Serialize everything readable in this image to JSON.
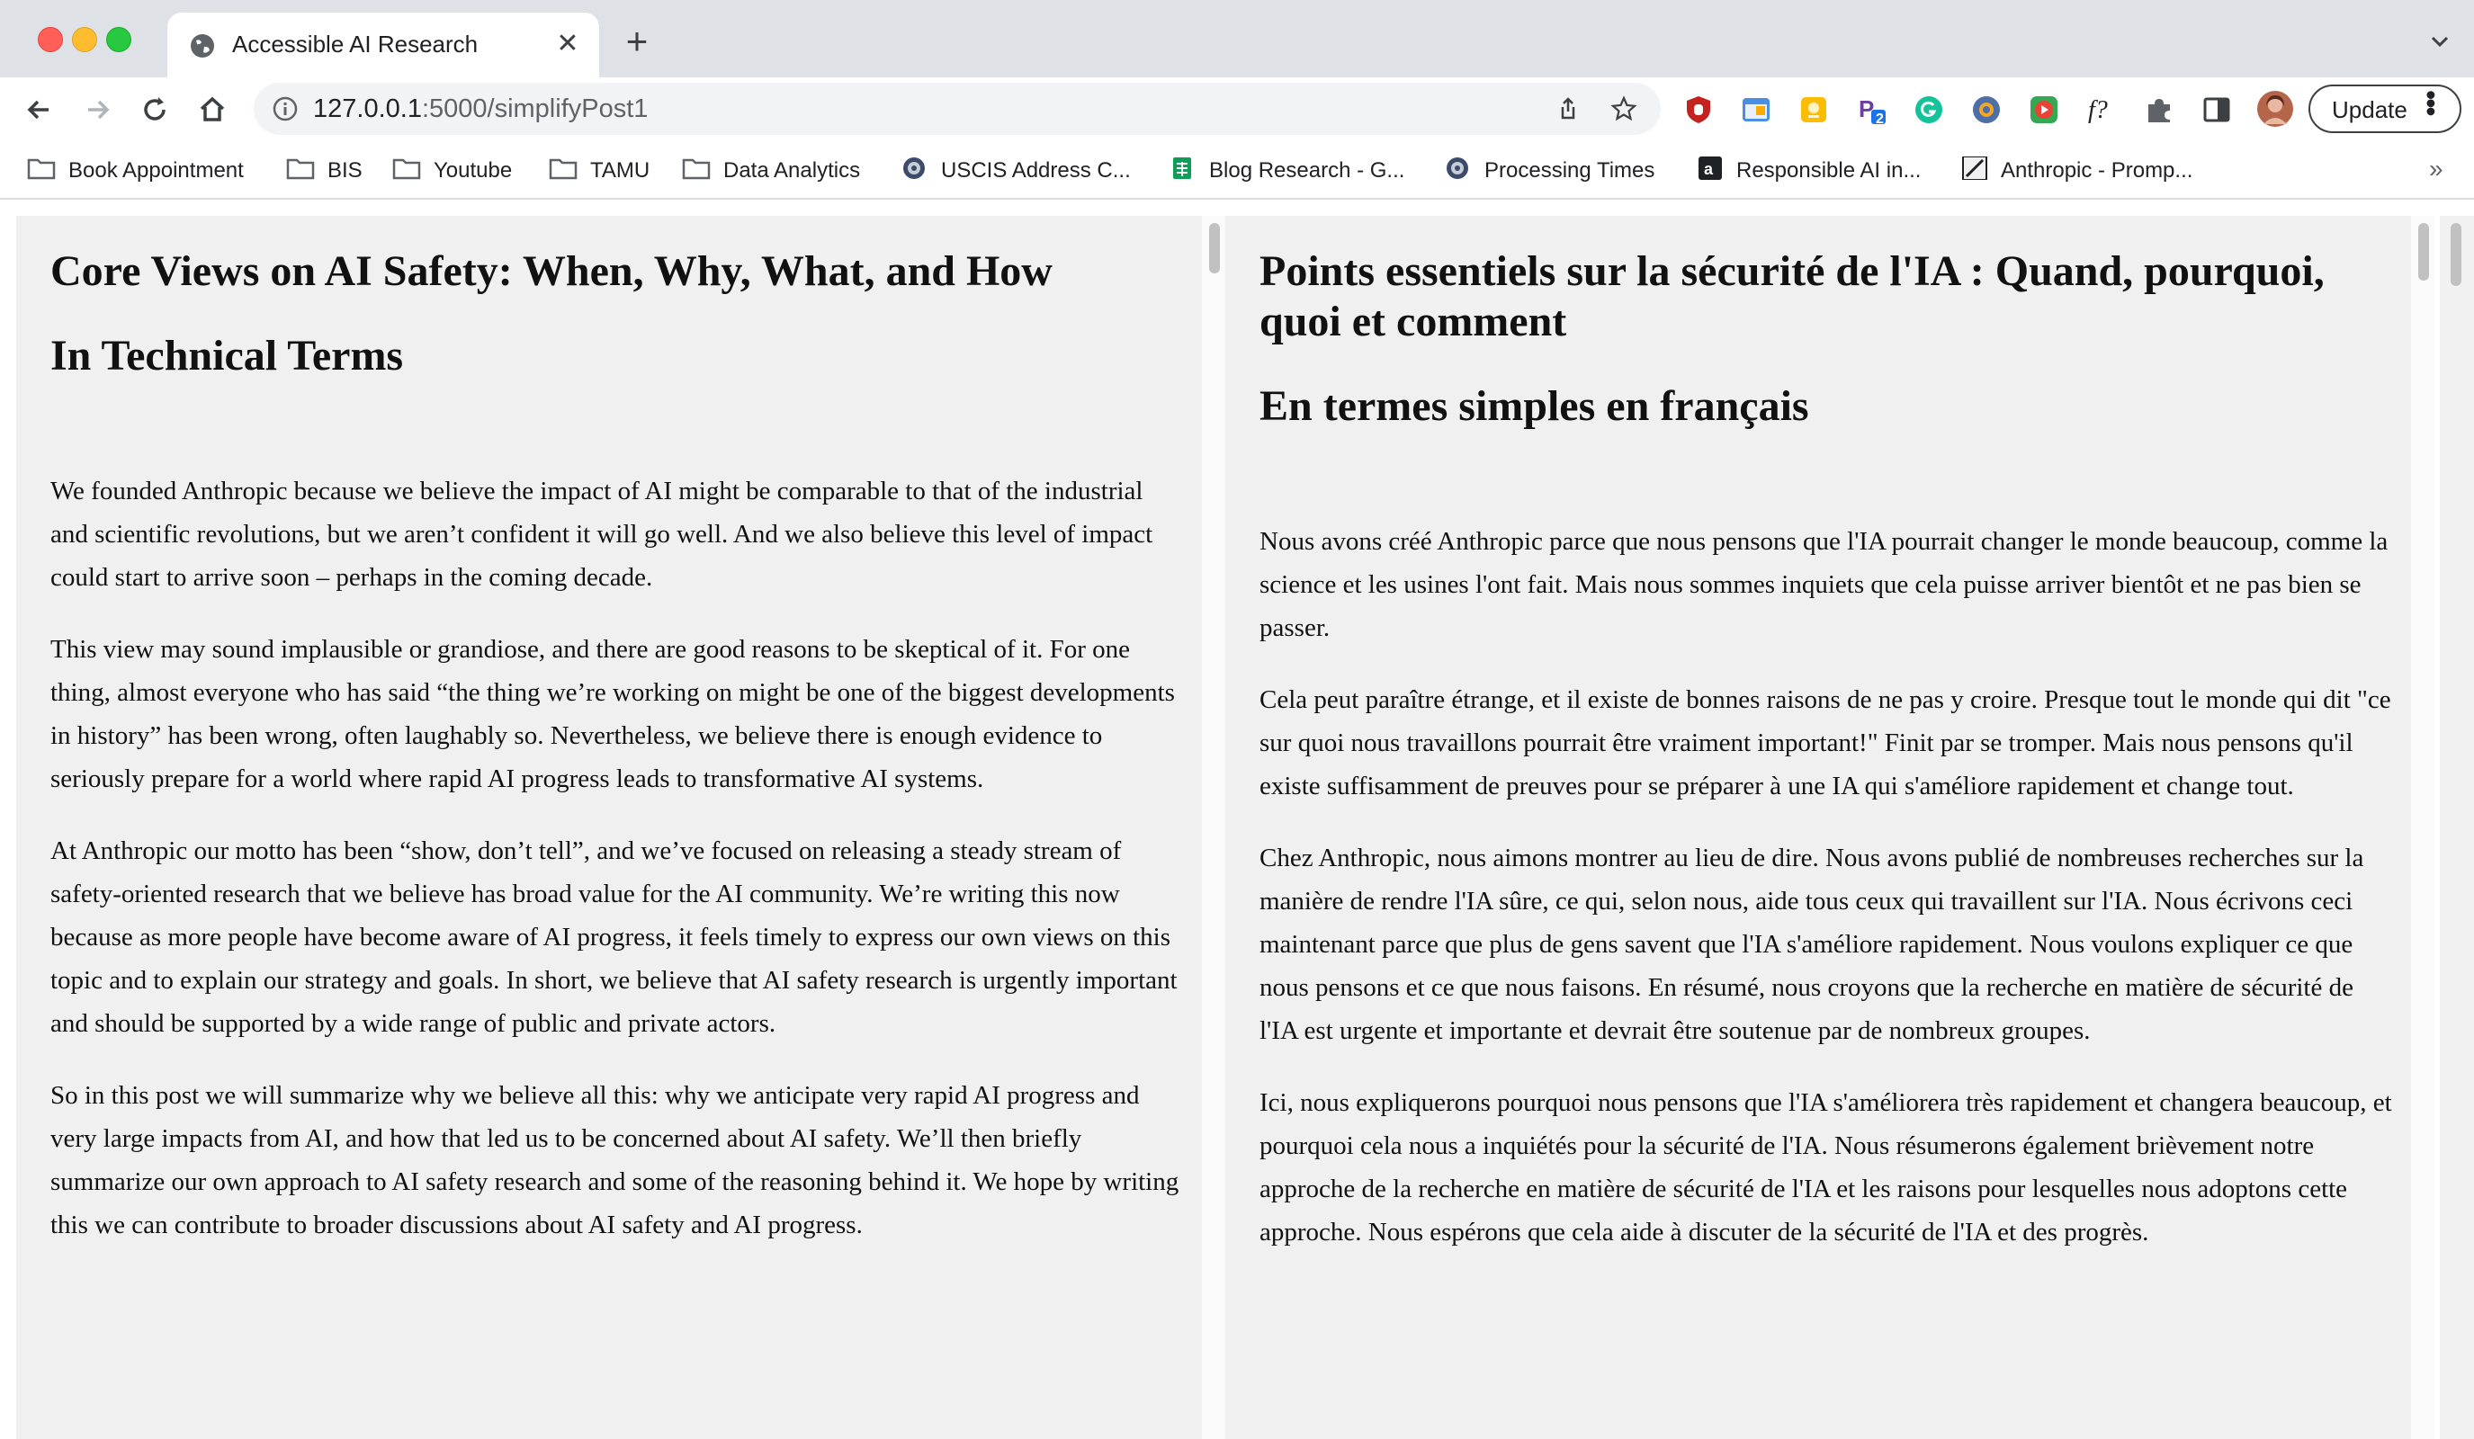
{
  "browser": {
    "tab_title": "Accessible AI Research",
    "url_host": "127.0.0.1",
    "url_path": ":5000/simplifyPost1",
    "update_label": "Update",
    "bookmarks": [
      {
        "label": "Book Appointment",
        "icon": "folder-icon"
      },
      {
        "label": "BIS",
        "icon": "folder-icon"
      },
      {
        "label": "Youtube",
        "icon": "folder-icon"
      },
      {
        "label": "TAMU",
        "icon": "folder-icon"
      },
      {
        "label": "Data Analytics",
        "icon": "folder-icon"
      },
      {
        "label": "USCIS Address C...",
        "icon": "seal-icon"
      },
      {
        "label": "Blog Research - G...",
        "icon": "sheets-icon"
      },
      {
        "label": "Processing Times",
        "icon": "seal-icon"
      },
      {
        "label": "Responsible AI in...",
        "icon": "a-icon"
      },
      {
        "label": "Anthropic - Promp...",
        "icon": "anthropic-icon"
      }
    ],
    "extensions": [
      "ublock-icon",
      "tab-manager-icon",
      "sticky-note-icon",
      "p-extension-icon",
      "grammarly-icon",
      "browser-ext-icon",
      "video-ext-icon",
      "formula-icon",
      "puzzle-icon",
      "side-panel-icon",
      "profile-avatar"
    ],
    "extension_badge": "2"
  },
  "left": {
    "title": "Core Views on AI Safety: When, Why, What, and How",
    "subtitle": "In Technical Terms",
    "paragraphs": [
      "We founded Anthropic because we believe the impact of AI might be comparable to that of the industrial and scientific revolutions, but we aren’t confident it will go well. And we also believe this level of impact could start to arrive soon – perhaps in the coming decade.",
      "This view may sound implausible or grandiose, and there are good reasons to be skeptical of it. For one thing, almost everyone who has said “the thing we’re working on might be one of the biggest developments in history” has been wrong, often laughably so. Nevertheless, we believe there is enough evidence to seriously prepare for a world where rapid AI progress leads to transformative AI systems.",
      "At Anthropic our motto has been “show, don’t tell”, and we’ve focused on releasing a steady stream of safety-oriented research that we believe has broad value for the AI community. We’re writing this now because as more people have become aware of AI progress, it feels timely to express our own views on this topic and to explain our strategy and goals. In short, we believe that AI safety research is urgently important and should be supported by a wide range of public and private actors.",
      "So in this post we will summarize why we believe all this: why we anticipate very rapid AI progress and very large impacts from AI, and how that led us to be concerned about AI safety. We’ll then briefly summarize our own approach to AI safety research and some of the reasoning behind it. We hope by writing this we can contribute to broader discussions about AI safety and AI progress."
    ]
  },
  "right": {
    "title": "Points essentiels sur la sécurité de l'IA : Quand, pourquoi, quoi et comment",
    "subtitle": "En termes simples en français",
    "paragraphs": [
      "Nous avons créé Anthropic parce que nous pensons que l'IA pourrait changer le monde beaucoup, comme la science et les usines l'ont fait. Mais nous sommes inquiets que cela puisse arriver bientôt et ne pas bien se passer.",
      "Cela peut paraître étrange, et il existe de bonnes raisons de ne pas y croire. Presque tout le monde qui dit \"ce sur quoi nous travaillons pourrait être vraiment important!\" Finit par se tromper. Mais nous pensons qu'il existe suffisamment de preuves pour se préparer à une IA qui s'améliore rapidement et change tout.",
      "Chez Anthropic, nous aimons montrer au lieu de dire. Nous avons publié de nombreuses recherches sur la manière de rendre l'IA sûre, ce qui, selon nous, aide tous ceux qui travaillent sur l'IA. Nous écrivons ceci maintenant parce que plus de gens savent que l'IA s'améliore rapidement. Nous voulons expliquer ce que nous pensons et ce que nous faisons. En résumé, nous croyons que la recherche en matière de sécurité de l'IA est urgente et importante et devrait être soutenue par de nombreux groupes.",
      "Ici, nous expliquerons pourquoi nous pensons que l'IA s'améliorera très rapidement et changera beaucoup, et pourquoi cela nous a inquiétés pour la sécurité de l'IA. Nous résumerons également brièvement notre approche de la recherche en matière de sécurité de l'IA et les raisons pour lesquelles nous adoptons cette approche. Nous espérons que cela aide à discuter de la sécurité de l'IA et des progrès."
    ]
  }
}
